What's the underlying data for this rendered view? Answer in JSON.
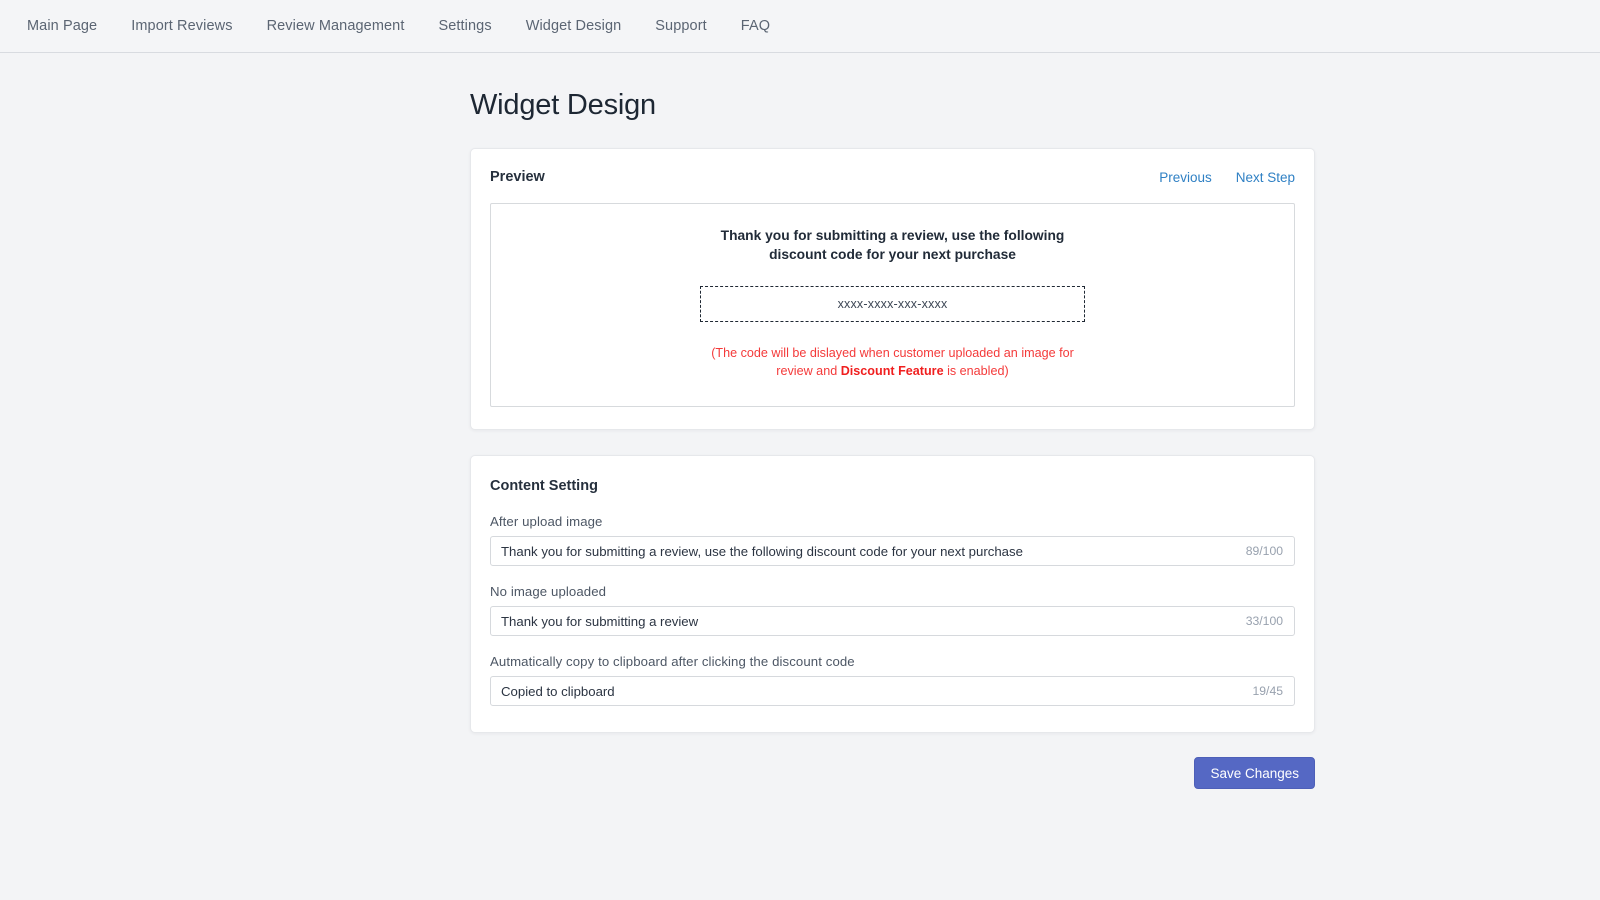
{
  "nav": {
    "items": [
      {
        "label": "Main Page",
        "name": "nav-item-main-page"
      },
      {
        "label": "Import Reviews",
        "name": "nav-item-import-reviews"
      },
      {
        "label": "Review Management",
        "name": "nav-item-review-management"
      },
      {
        "label": "Settings",
        "name": "nav-item-settings"
      },
      {
        "label": "Widget Design",
        "name": "nav-item-widget-design"
      },
      {
        "label": "Support",
        "name": "nav-item-support"
      },
      {
        "label": "FAQ",
        "name": "nav-item-faq"
      }
    ]
  },
  "page": {
    "title": "Widget Design"
  },
  "preview": {
    "card_title": "Preview",
    "previous_label": "Previous",
    "next_label": "Next Step",
    "heading": "Thank you for submitting a review, use the following discount code for your next purchase",
    "code_placeholder": "xxxx-xxxx-xxx-xxxx",
    "note_prefix": "(The code will be dislayed when customer uploaded an image for review and ",
    "note_bold": "Discount Feature",
    "note_suffix": " is enabled)"
  },
  "content_setting": {
    "card_title": "Content Setting",
    "fields": [
      {
        "label": "After upload image",
        "value": "Thank you for submitting a review, use the following discount code for your next purchase",
        "counter": "89/100"
      },
      {
        "label": "No image uploaded",
        "value": "Thank you for submitting a review",
        "counter": "33/100"
      },
      {
        "label": "Autmatically copy to clipboard after clicking the discount code",
        "value": "Copied to clipboard",
        "counter": "19/45"
      }
    ]
  },
  "actions": {
    "save_label": "Save Changes"
  },
  "colors": {
    "page_background": "#f3f4f6",
    "card_background": "#ffffff",
    "link_blue": "#2f80c4",
    "primary_button": "#5568c4",
    "warning_red": "#f43a3a",
    "text_dark": "#1d2733"
  }
}
